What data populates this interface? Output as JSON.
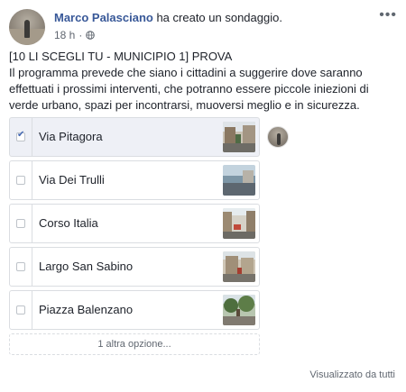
{
  "post": {
    "author": "Marco Palasciano",
    "action": "ha creato un sondaggio.",
    "time": "18 h",
    "title_line": "[10 LI SCEGLI TU - MUNICIPIO 1] PROVA",
    "body": "Il programma prevede che siano i cittadini a suggerire dove saranno effettuati i prossimi interventi, che potranno essere piccole iniezioni di verde urbano, spazi per incontrarsi, muoversi meglio e in sicurezza."
  },
  "poll": {
    "options": [
      {
        "label": "Via Pitagora",
        "checked": true
      },
      {
        "label": "Via Dei Trulli",
        "checked": false
      },
      {
        "label": "Corso Italia",
        "checked": false
      },
      {
        "label": "Largo San Sabino",
        "checked": false
      },
      {
        "label": "Piazza Balenzano",
        "checked": false
      }
    ],
    "more_options": "1 altra opzione...",
    "seen_by": "Visualizzato da tutti"
  },
  "icons": {
    "more": "more-options-icon",
    "privacy": "globe-icon",
    "checkbox": "checkbox-icon"
  },
  "colors": {
    "author": "#385898",
    "selected_bg": "#eef0f6",
    "check": "#4267b2"
  }
}
